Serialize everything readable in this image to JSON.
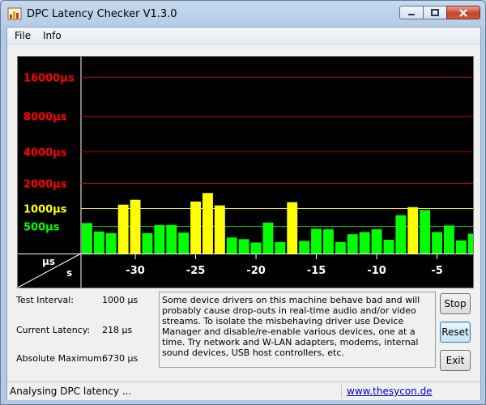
{
  "window": {
    "title": "DPC Latency Checker V1.3.0"
  },
  "menu": {
    "items": [
      "File",
      "Info"
    ]
  },
  "chart_data": {
    "type": "bar",
    "ylabels": [
      {
        "text": "16000µs",
        "color": "#ff0000"
      },
      {
        "text": "8000µs",
        "color": "#ff0000"
      },
      {
        "text": "4000µs",
        "color": "#ff0000"
      },
      {
        "text": "2000µs",
        "color": "#ff0000"
      },
      {
        "text": "1000µs",
        "color": "#ffff00"
      },
      {
        "text": "500µs",
        "color": "#00ff00"
      }
    ],
    "x_ticks": [
      -30,
      -25,
      -20,
      -15,
      -10,
      -5
    ],
    "x_unit_label": "s",
    "y_unit_label": "µs",
    "x_range": [
      -34,
      0
    ],
    "bars": [
      {
        "t": -34,
        "us": 560
      },
      {
        "t": -33,
        "us": 400
      },
      {
        "t": -32,
        "us": 370
      },
      {
        "t": -31,
        "us": 1100
      },
      {
        "t": -30,
        "us": 1260
      },
      {
        "t": -29,
        "us": 370
      },
      {
        "t": -28,
        "us": 520
      },
      {
        "t": -27,
        "us": 520
      },
      {
        "t": -26,
        "us": 380
      },
      {
        "t": -25,
        "us": 1200
      },
      {
        "t": -24,
        "us": 1520
      },
      {
        "t": -23,
        "us": 1080
      },
      {
        "t": -22,
        "us": 290
      },
      {
        "t": -21,
        "us": 260
      },
      {
        "t": -20,
        "us": 200
      },
      {
        "t": -19,
        "us": 570
      },
      {
        "t": -18,
        "us": 210
      },
      {
        "t": -17,
        "us": 1180
      },
      {
        "t": -16,
        "us": 230
      },
      {
        "t": -15,
        "us": 450
      },
      {
        "t": -14,
        "us": 440
      },
      {
        "t": -13,
        "us": 210
      },
      {
        "t": -12,
        "us": 350
      },
      {
        "t": -11,
        "us": 390
      },
      {
        "t": -10,
        "us": 440
      },
      {
        "t": -9,
        "us": 250
      },
      {
        "t": -8,
        "us": 760
      },
      {
        "t": -7,
        "us": 1030
      },
      {
        "t": -6,
        "us": 930
      },
      {
        "t": -5,
        "us": 390
      },
      {
        "t": -4,
        "us": 510
      },
      {
        "t": -3,
        "us": 240
      },
      {
        "t": -2,
        "us": 360
      }
    ],
    "colors": {
      "green": "#00ff00",
      "yellow": "#ffff00",
      "red": "#ff0000",
      "grid_red": "#b00000",
      "grid_yellow": "#ffff00",
      "grid_green": "#00c000"
    }
  },
  "info": {
    "test_interval_label": "Test Interval:",
    "test_interval_value": "1000 µs",
    "current_latency_label": "Current Latency:",
    "current_latency_value": "218 µs",
    "absolute_max_label": "Absolute Maximum:",
    "absolute_max_value": "6730 µs"
  },
  "message": "Some device drivers on this machine behave bad and will probably cause drop-outs in real-time audio and/or video streams. To isolate the misbehaving driver use Device Manager and disable/re-enable various devices, one at a time. Try network and W-LAN adapters, modems, internal sound devices, USB host controllers, etc.",
  "buttons": {
    "stop": "Stop",
    "reset": "Reset",
    "exit": "Exit"
  },
  "status": {
    "text": "Analysing DPC latency ...",
    "link": "www.thesycon.de"
  }
}
